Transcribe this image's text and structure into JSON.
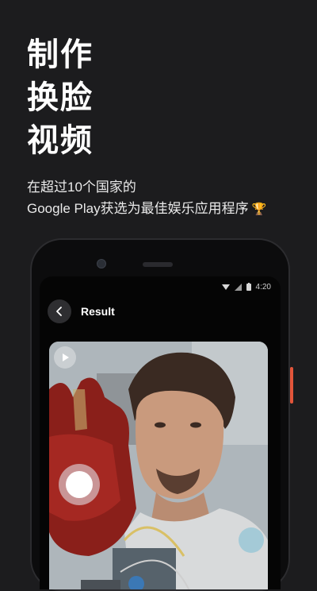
{
  "headline": {
    "line1": "制作",
    "line2": "换脸",
    "line3": "视频"
  },
  "subtitle": {
    "line1": "在超过10个国家的",
    "line2": "Google Play获选为最佳娱乐应用程序",
    "badge_icon": "trophy-icon"
  },
  "phone": {
    "status_time": "4:20",
    "status_icons": [
      "wifi-icon",
      "signal-icon",
      "battery-icon"
    ],
    "app_bar": {
      "back_icon": "back-arrow-icon",
      "title": "Result"
    },
    "result": {
      "play_icon": "play-icon",
      "image_desc": "face-swapped-person-with-iron-glove"
    }
  },
  "colors": {
    "background": "#1c1c1e",
    "accent": "#e2553a"
  }
}
